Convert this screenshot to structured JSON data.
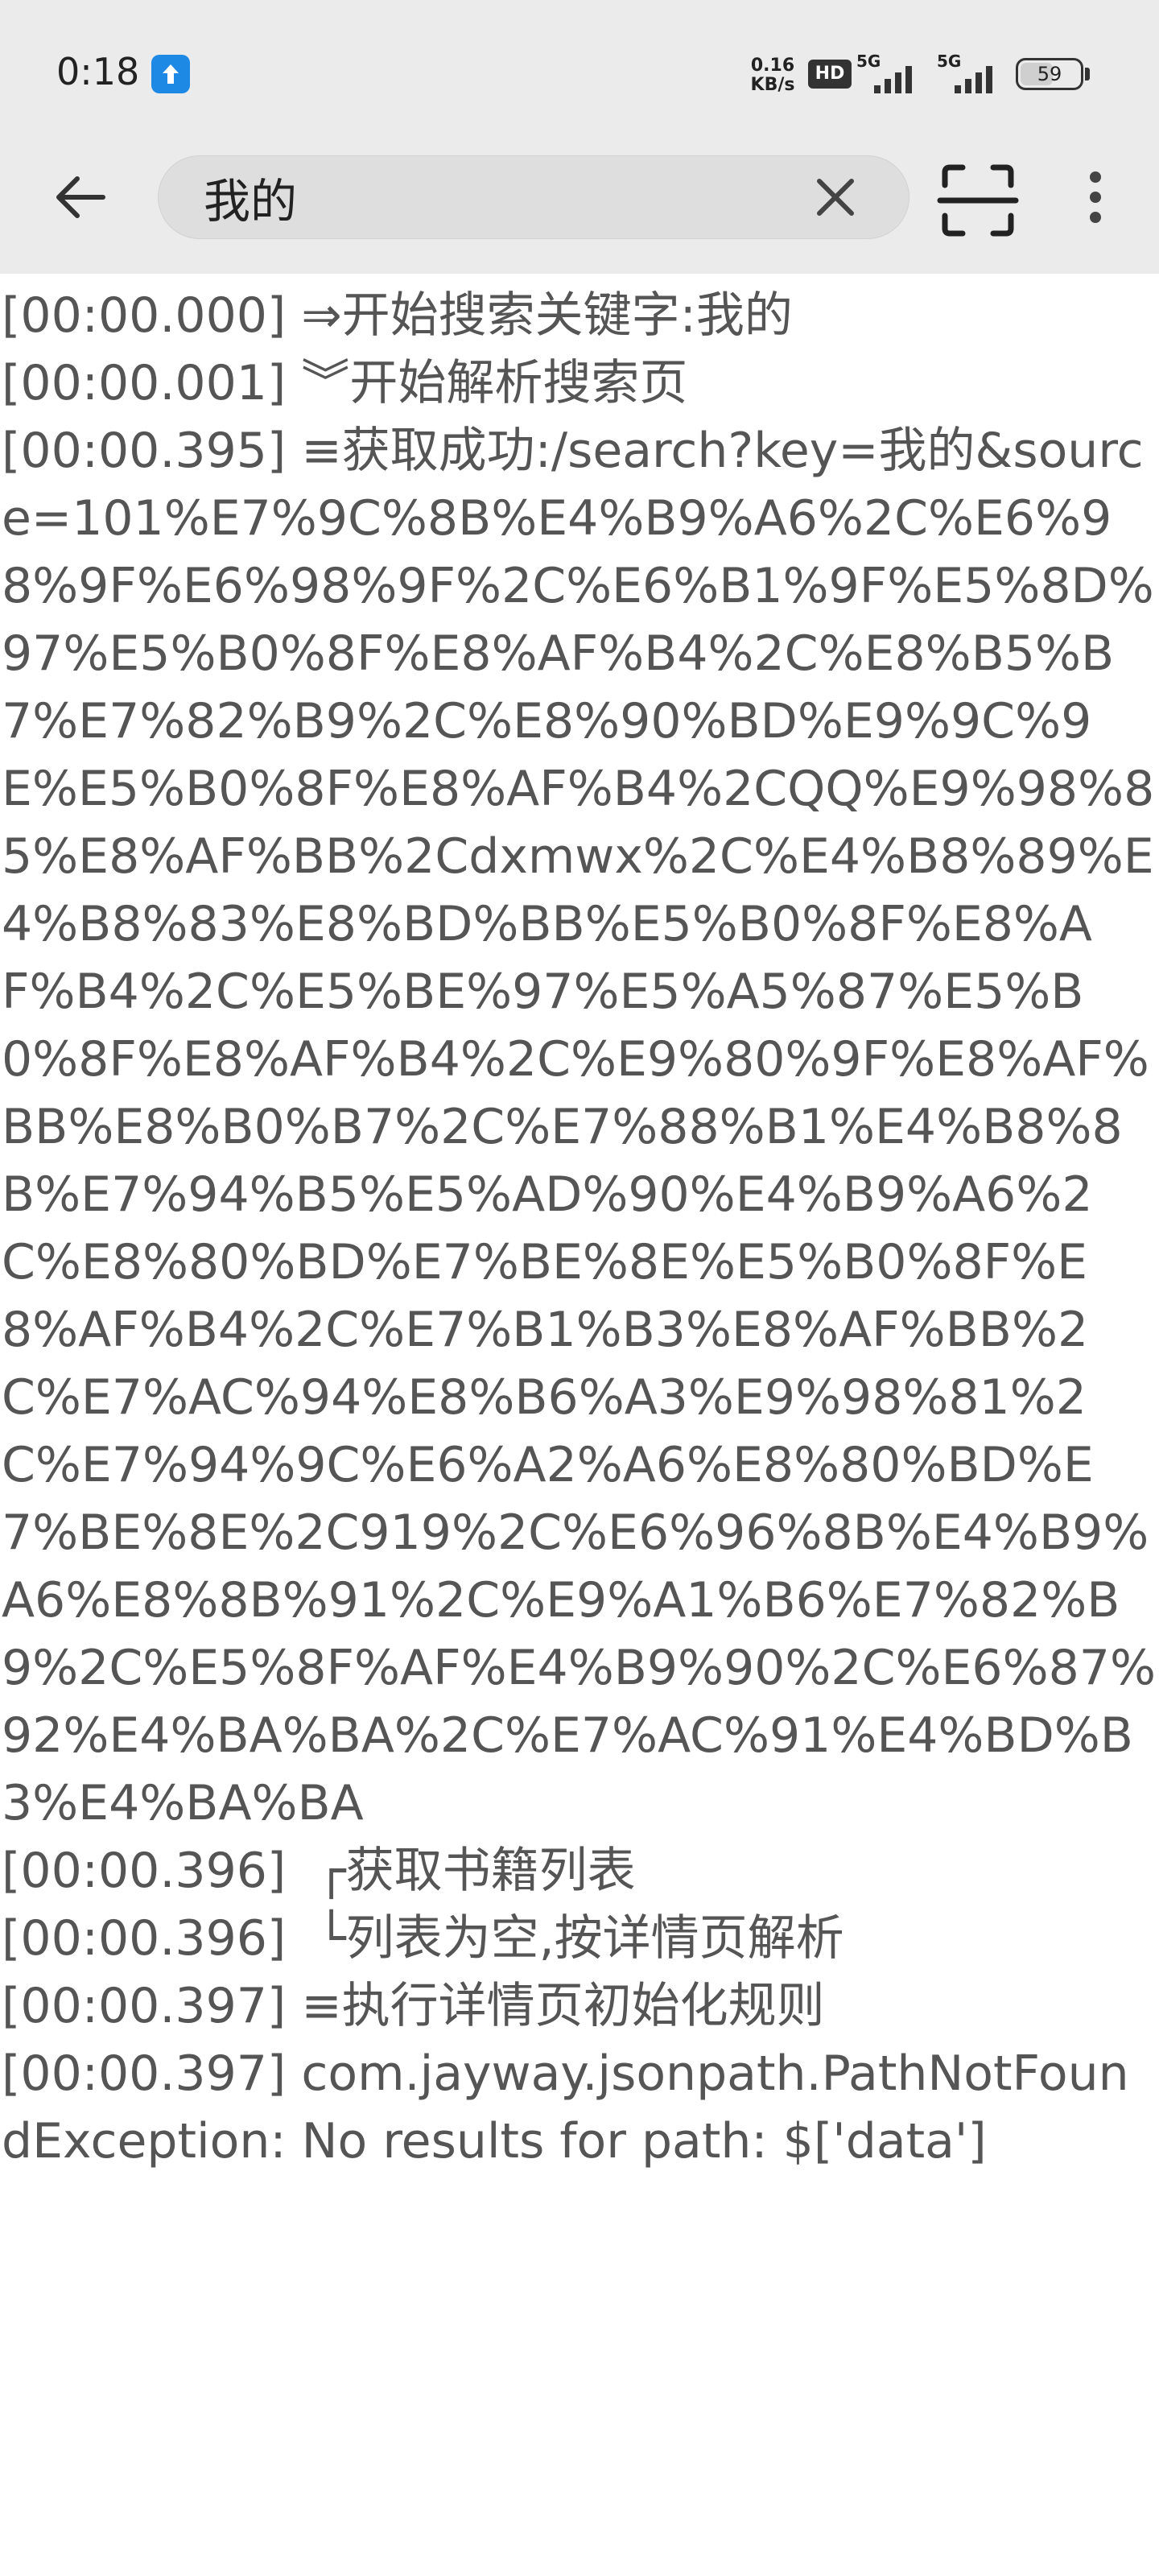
{
  "status_bar": {
    "time": "0:18",
    "net_speed_value": "0.16",
    "net_speed_unit": "KB/s",
    "hd_label": "HD",
    "signal_1_label": "5G",
    "signal_2_label": "5G",
    "battery_percent": "59",
    "battery_level_fraction": 0.59
  },
  "toolbar": {
    "search_value": "我的",
    "icons": [
      "arrow-left-icon",
      "close-icon",
      "scan-icon",
      "more-vertical-icon"
    ]
  },
  "log": [
    "[00:00.000] ⇒开始搜索关键字:我的",
    "[00:00.001] ︾开始解析搜索页",
    "[00:00.395] ≡获取成功:/search?key=我的&source=101%E7%9C%8B%E4%B9%A6%2C%E6%98%9F%E6%98%9F%2C%E6%B1%9F%E5%8D%97%E5%B0%8F%E8%AF%B4%2C%E8%B5%B7%E7%82%B9%2C%E8%90%BD%E9%9C%9E%E5%B0%8F%E8%AF%B4%2CQQ%E9%98%85%E8%AF%BB%2Cdxmwx%2C%E4%B8%89%E4%B8%83%E8%BD%BB%E5%B0%8F%E8%AF%B4%2C%E5%BE%97%E5%A5%87%E5%B0%8F%E8%AF%B4%2C%E9%80%9F%E8%AF%BB%E8%B0%B7%2C%E7%88%B1%E4%B8%8B%E7%94%B5%E5%AD%90%E4%B9%A6%2C%E8%80%BD%E7%BE%8E%E5%B0%8F%E8%AF%B4%2C%E7%B1%B3%E8%AF%BB%2C%E7%AC%94%E8%B6%A3%E9%98%81%2C%E7%94%9C%E6%A2%A6%E8%80%BD%E7%BE%8E%2C919%2C%E6%96%8B%E4%B9%A6%E8%8B%91%2C%E9%A1%B6%E7%82%B9%2C%E5%8F%AF%E4%B9%90%2C%E6%87%92%E4%BA%BA%2C%E7%AC%91%E4%BD%B3%E4%BA%BA",
    "[00:00.396]  ┌获取书籍列表",
    "[00:00.396]  └列表为空,按详情页解析",
    "[00:00.397] ≡执行详情页初始化规则",
    "[00:00.397] com.jayway.jsonpath.PathNotFoundException: No results for path: $['data']"
  ]
}
